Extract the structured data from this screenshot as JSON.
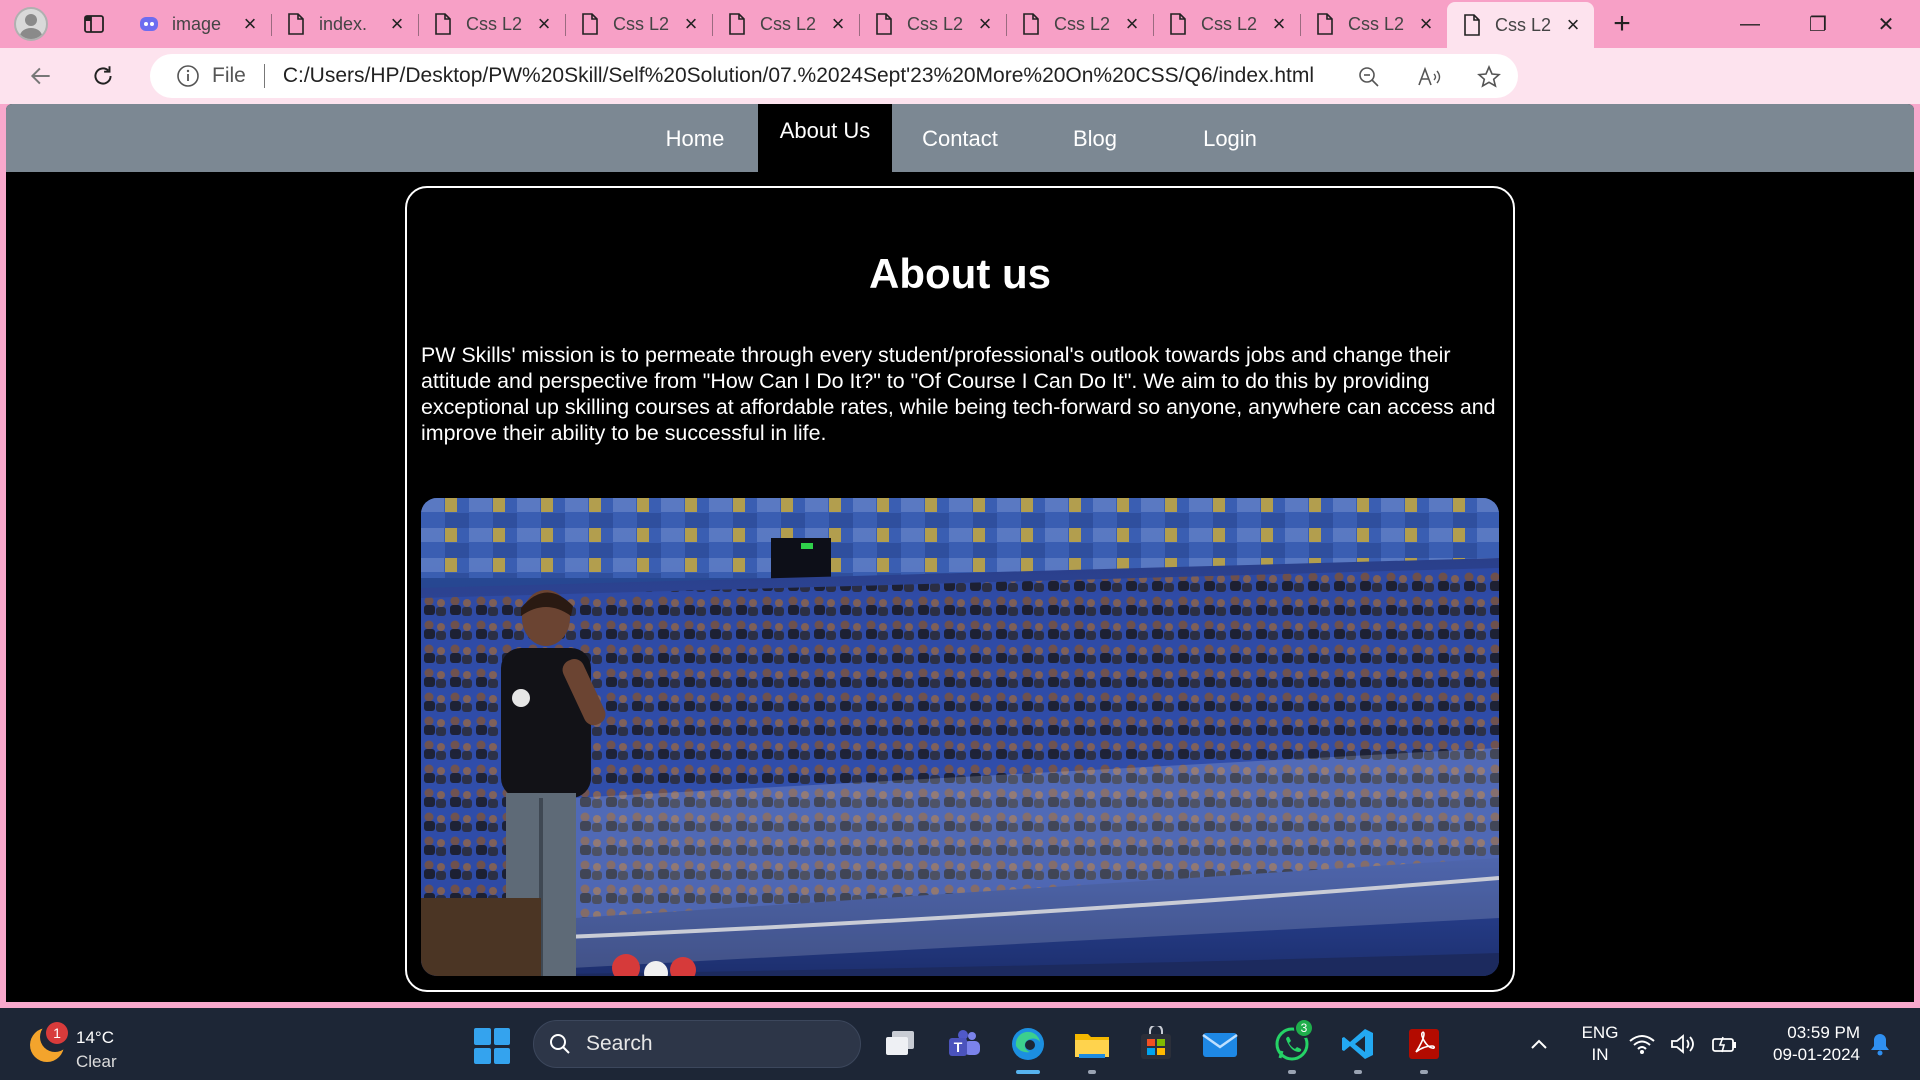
{
  "browser": {
    "tabs": [
      {
        "title": "image",
        "icon": "copilot-icon"
      },
      {
        "title": "index.",
        "icon": "file-icon"
      },
      {
        "title": "Css L2",
        "icon": "file-icon"
      },
      {
        "title": "Css L2",
        "icon": "file-icon"
      },
      {
        "title": "Css L2",
        "icon": "file-icon"
      },
      {
        "title": "Css L2",
        "icon": "file-icon"
      },
      {
        "title": "Css L2",
        "icon": "file-icon"
      },
      {
        "title": "Css L2",
        "icon": "file-icon"
      },
      {
        "title": "Css L2",
        "icon": "file-icon"
      },
      {
        "title": "Css L2",
        "icon": "file-icon",
        "active": true
      }
    ],
    "address": {
      "scheme_label": "File",
      "url": "C:/Users/HP/Desktop/PW%20Skill/Self%20Solution/07.%2024Sept'23%20More%20On%20CSS/Q6/index.html"
    },
    "accent": "#f7a0c6"
  },
  "site": {
    "nav": [
      "Home",
      "About Us",
      "Contact",
      "Blog",
      "Login"
    ],
    "active_nav": "About Us",
    "heading": "About us",
    "paragraph": "PW Skills' mission is to permeate through every student/professional's outlook towards jobs and change their attitude and perspective from \"How Can I Do It?\" to \"Of Course I Can Do It\". We aim to do this by providing exceptional up skilling courses at affordable rates, while being tech-forward so anyone, anywhere can access and improve their ability to be successful in life.",
    "nav_bg": "#7c8893",
    "page_bg": "#000000"
  },
  "taskbar": {
    "weather": {
      "temp": "14°C",
      "condition": "Clear",
      "badge": "1"
    },
    "search_label": "Search",
    "whatsapp_count": "3",
    "language": {
      "line1": "ENG",
      "line2": "IN"
    },
    "clock": {
      "time": "03:59 PM",
      "date": "09-01-2024"
    }
  }
}
